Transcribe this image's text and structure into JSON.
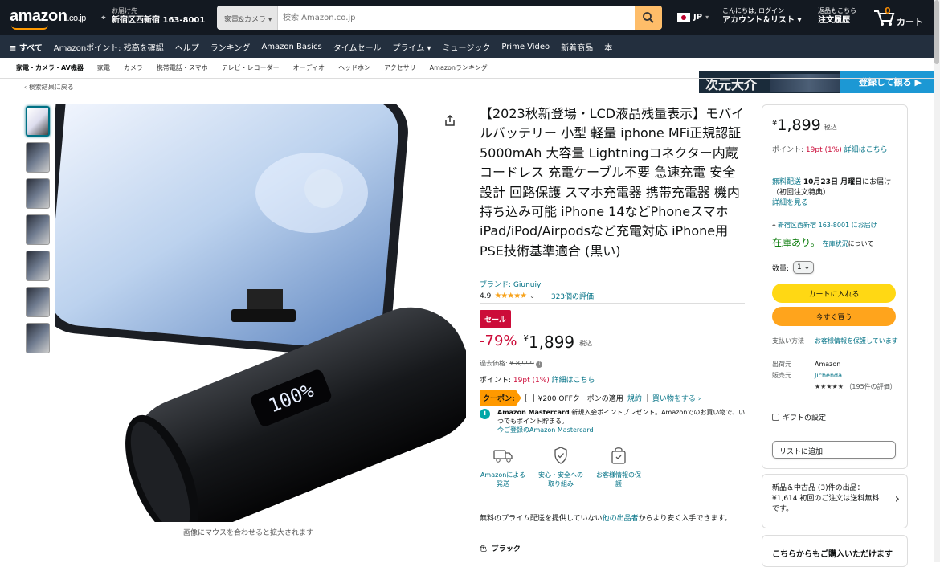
{
  "header": {
    "logo": "amazon",
    "logo_tld": ".co.jp",
    "deliver_label": "お届け先",
    "deliver_address": "新宿区西新宿 163-8001",
    "search_category": "家電&カメラ ▾",
    "search_placeholder": "検索 Amazon.co.jp",
    "lang": "JP",
    "account_small": "こんにちは, ログイン",
    "account_big": "アカウント＆リスト",
    "orders_small": "返品もこちら",
    "orders_big": "注文履歴",
    "cart_count": "0",
    "cart_label": "カート"
  },
  "navbar": {
    "items": [
      "≡ すべて",
      "Amazonポイント: 残高を確認",
      "ヘルプ",
      "ランキング",
      "Amazon Basics",
      "タイムセール",
      "プライム ▾",
      "ミュージック",
      "Prime Video",
      "新着商品",
      "本"
    ],
    "banner_title": "次元大介",
    "banner_cta": "登録して観る ▶"
  },
  "subnav": {
    "items": [
      "家電・カメラ・AV機器",
      "家電",
      "カメラ",
      "携帯電話・スマホ",
      "テレビ・レコーダー",
      "オーディオ",
      "ヘッドホン",
      "アクセサリ",
      "Amazonランキング"
    ]
  },
  "back_link": "‹ 検索結果に戻る",
  "gallery": {
    "caption": "画像にマウスを合わせると拡大されます",
    "screen_display": "100%"
  },
  "product": {
    "title": "【2023秋新登場・LCD液晶残量表示】モバイルバッテリー 小型 軽量 iphone MFi正規認証 5000mAh 大容量 Lightningコネクター内蔵 コードレス 充電ケーブル不要 急速充電 安全設計 回路保護 スマホ充電器 携帯充電器 機内持ち込み可能 iPhone 14などPhoneスマホ iPad/iPod/Airpodsなど充電対応 iPhone用 PSE技術基準適合 (黒い)",
    "brand": "ブランド: Giunuiy",
    "rating": "4.9",
    "stars": "★★★★★",
    "rating_count": "323個の評価",
    "sale_badge": "セール",
    "discount": "-79%",
    "currency": "¥",
    "price": "1,899",
    "tax": "税込",
    "list_price_label": "過去価格:",
    "list_price": "¥ 8,999",
    "points_label": "ポイント:",
    "points_value": "19pt (1%)",
    "points_link": "詳細はこちら",
    "coupon_label": "クーポン:",
    "coupon_text": "¥200 OFFクーポンの適用",
    "coupon_terms": "規約",
    "coupon_shop": "買い物をする ›",
    "mc_text_bold": "Amazon Mastercard",
    "mc_text": " 新規入会ポイントプレゼント。Amazonでのお買い物で、いつでもポイント貯まる。",
    "mc_link": "今ご登録のAmazon Mastercard",
    "badges": [
      {
        "icon": "truck-icon",
        "label": "Amazonによる発送"
      },
      {
        "icon": "shield-icon",
        "label": "安心・安全への取り組み"
      },
      {
        "icon": "secure-bag-icon",
        "label": "お客様情報の保護"
      }
    ],
    "other_sellers_pre": "無料のプライム配送を提供していない",
    "other_sellers_link": "他の出品者",
    "other_sellers_post": "からより安く入手できます。",
    "color_label": "色:",
    "color_value": "ブラック"
  },
  "buybox": {
    "currency": "¥",
    "price": "1,899",
    "tax": "税込",
    "points_label": "ポイント:",
    "points_value": "19pt (1%)",
    "points_link": "詳細はこちら",
    "free_delivery": "無料配送",
    "delivery_date": "10月23日 月曜日",
    "delivery_rest": "にお届け（初回注文特典）",
    "details_link": "詳細を見る",
    "location": "新宿区西新宿 163-8001 にお届け",
    "stock": "在庫あり。",
    "stock_link": "在庫状況",
    "stock_note": "について",
    "qty_label": "数量:",
    "qty_value": "1 ⌄",
    "add_to_cart": "カートに入れる",
    "buy_now": "今すぐ買う",
    "payment_key": "支払い方法",
    "payment_val": "お客様情報を保護しています",
    "ships_key": "出荷元",
    "ships_val": "Amazon",
    "sold_key": "販売元",
    "sold_val": "Jichenda",
    "seller_stars": "★★★★★",
    "seller_rating_count": "（195件の評価）",
    "gift_label": "ギフトの設定",
    "add_to_list": "リストに追加"
  },
  "new_used": {
    "text": "新品＆中古品 (3)件の出品：¥1,614 初回のご注文は送料無料です。"
  },
  "also_buy": {
    "title": "こちらからもご購入いただけます"
  },
  "colors": {
    "navy": "#131921",
    "nav2": "#232f3e",
    "accent": "#ff9900",
    "link": "#007185",
    "deal_red": "#cc0c39",
    "cart_yellow": "#ffd814",
    "buy_orange": "#ffa41c"
  }
}
